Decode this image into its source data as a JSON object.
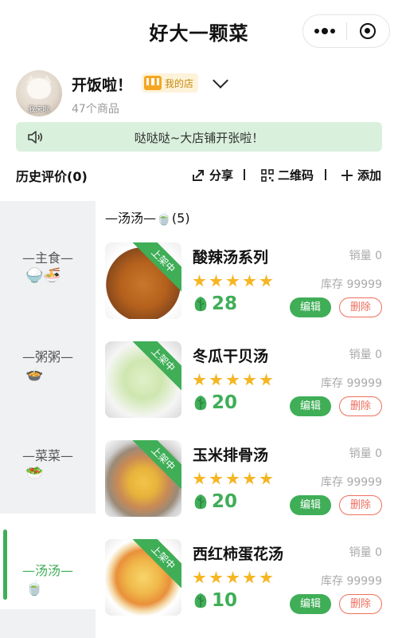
{
  "header": {
    "title": "好大一颗菜"
  },
  "store": {
    "avatar_caption": "我来啦",
    "name": "开饭啦！",
    "badge_label": "我的店",
    "goods_count": "47个商品"
  },
  "notice": {
    "text": "哒哒哒~大店铺开张啦！"
  },
  "toolbar": {
    "history_label": "历史评价(0)",
    "share_label": "分享",
    "qrcode_label": "二维码",
    "add_label": "添加"
  },
  "sidebar": {
    "categories": [
      {
        "label": "—主食—",
        "emoji": "🍚🍜"
      },
      {
        "label": "—粥粥—",
        "emoji": "🍲"
      },
      {
        "label": "—菜菜—",
        "emoji": "🥗"
      },
      {
        "label": "—汤汤—",
        "emoji": "🍵"
      }
    ],
    "active_index": 3
  },
  "content": {
    "section_title": "—汤汤—🍵(5)",
    "items": [
      {
        "name": "酸辣汤系列",
        "sales": "销量 0",
        "stock": "库存 99999",
        "price": "28",
        "rating": 5,
        "status": "上架中",
        "edit": "编辑",
        "delete": "删除"
      },
      {
        "name": "冬瓜干贝汤",
        "sales": "销量 0",
        "stock": "库存 99999",
        "price": "20",
        "rating": 5,
        "status": "上架中",
        "edit": "编辑",
        "delete": "删除"
      },
      {
        "name": "玉米排骨汤",
        "sales": "销量 0",
        "stock": "库存 99999",
        "price": "20",
        "rating": 5,
        "status": "上架中",
        "edit": "编辑",
        "delete": "删除"
      },
      {
        "name": "西红柿蛋花汤",
        "sales": "销量 0",
        "stock": "库存 99999",
        "price": "10",
        "rating": 5,
        "status": "上架中",
        "edit": "编辑",
        "delete": "删除"
      }
    ]
  },
  "colors": {
    "accent": "#3fae57",
    "danger": "#ef6f5e",
    "notice_bg": "#d9f0dc",
    "star": "#f5b623"
  }
}
